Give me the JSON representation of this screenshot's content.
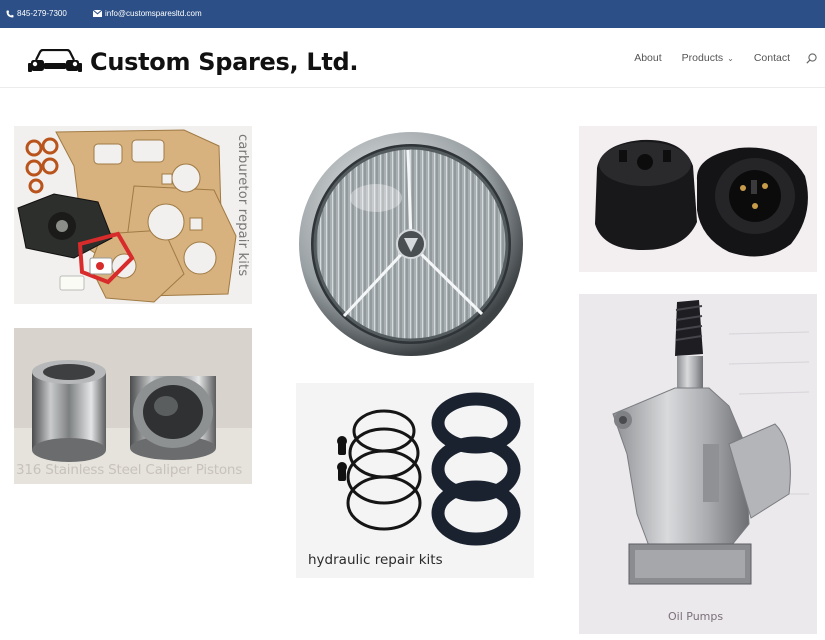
{
  "topbar": {
    "phone": "845-279-7300",
    "email": "info@customsparesltd.com",
    "background": "#2b4f86"
  },
  "header": {
    "brand": "Custom Spares, Ltd.",
    "nav": [
      {
        "label": "About"
      },
      {
        "label": "Products"
      },
      {
        "label": "Contact"
      }
    ]
  },
  "tiles": {
    "carburetor": "carburetor repair kits",
    "pistons": "316 Stainless Steel Caliper Pistons",
    "hydraulic": "hydraulic repair kits",
    "oil_pumps": "Oil Pumps"
  },
  "icons": {
    "phone": "phone-icon",
    "mail": "mail-icon",
    "logo": "car-logo-icon",
    "dropdown": "chevron-down-icon",
    "search": "search-icon"
  }
}
